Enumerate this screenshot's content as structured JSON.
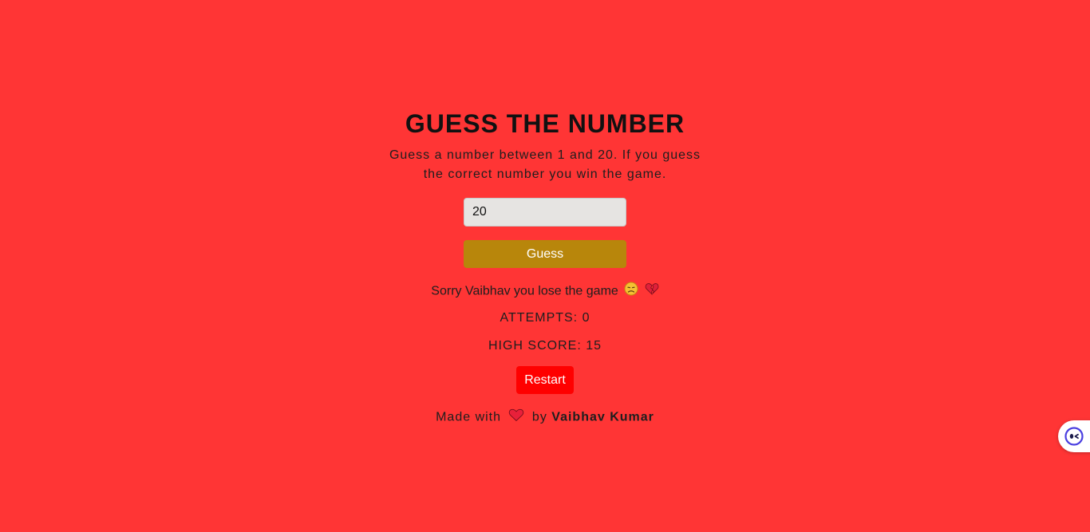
{
  "colors": {
    "background": "#ff3535",
    "guess_button": "#b8860b",
    "restart_button": "#ff0000",
    "input_background": "#e6e4e2"
  },
  "game": {
    "title": "GUESS THE NUMBER",
    "description": "Guess a number between 1 and 20. If you guess the correct number you win the game.",
    "input_value": "20",
    "guess_label": "Guess",
    "message": "Sorry Vaibhav you lose the game",
    "message_icons": [
      "disappointed-face-icon",
      "broken-heart-icon"
    ],
    "attempts": "ATTEMPTS: 0",
    "high_score": "HIGH SCORE: 15",
    "restart_label": "Restart"
  },
  "footer": {
    "made_with": "Made with",
    "heart_icon": "heart-icon",
    "by": "by",
    "author": "Vaibhav Kumar"
  },
  "widget": {
    "icon": "assistant-face-icon"
  }
}
